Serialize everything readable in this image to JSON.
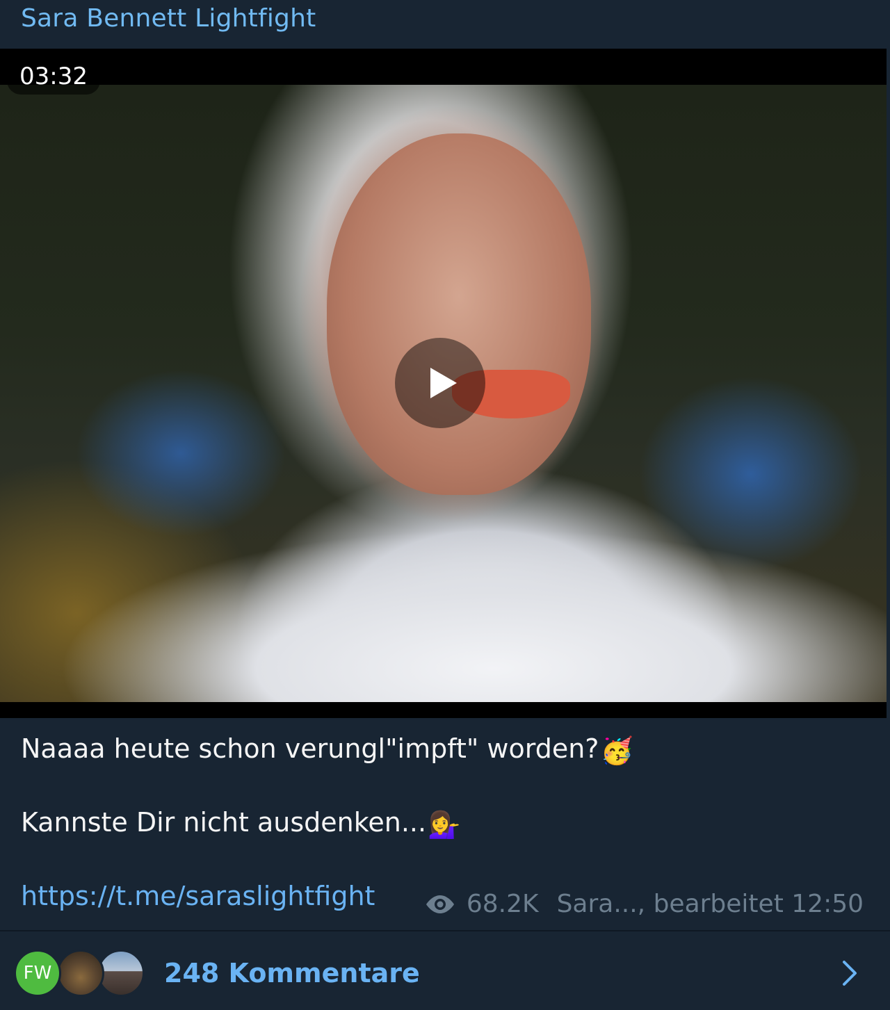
{
  "header": {
    "channel_name": "Sara Bennett Lightfight"
  },
  "video": {
    "duration": "03:32",
    "play_icon": "play-icon"
  },
  "caption": {
    "line1": "Naaaa heute schon verungl\"impft\" worden?",
    "line1_emoji": "🥳",
    "line2": "Kannste Dir nicht ausdenken...",
    "line2_emoji": "💁‍♀️",
    "link": "https://t.me/saraslightfight"
  },
  "meta": {
    "views_icon": "eye-icon",
    "views": "68.2K",
    "author_edited": "Sara..., bearbeitet 12:50"
  },
  "comments": {
    "avatars": [
      {
        "name": "fw-avatar",
        "initials": "FW",
        "color": "#4fbb40"
      },
      {
        "name": "deer-avatar"
      },
      {
        "name": "building-avatar"
      }
    ],
    "label": "248 Kommentare",
    "chevron_icon": "chevron-right-icon"
  },
  "colors": {
    "background": "#182533",
    "accent": "#6ab3f3",
    "channel_name": "#71baf2",
    "meta": "#6d7f8f"
  }
}
